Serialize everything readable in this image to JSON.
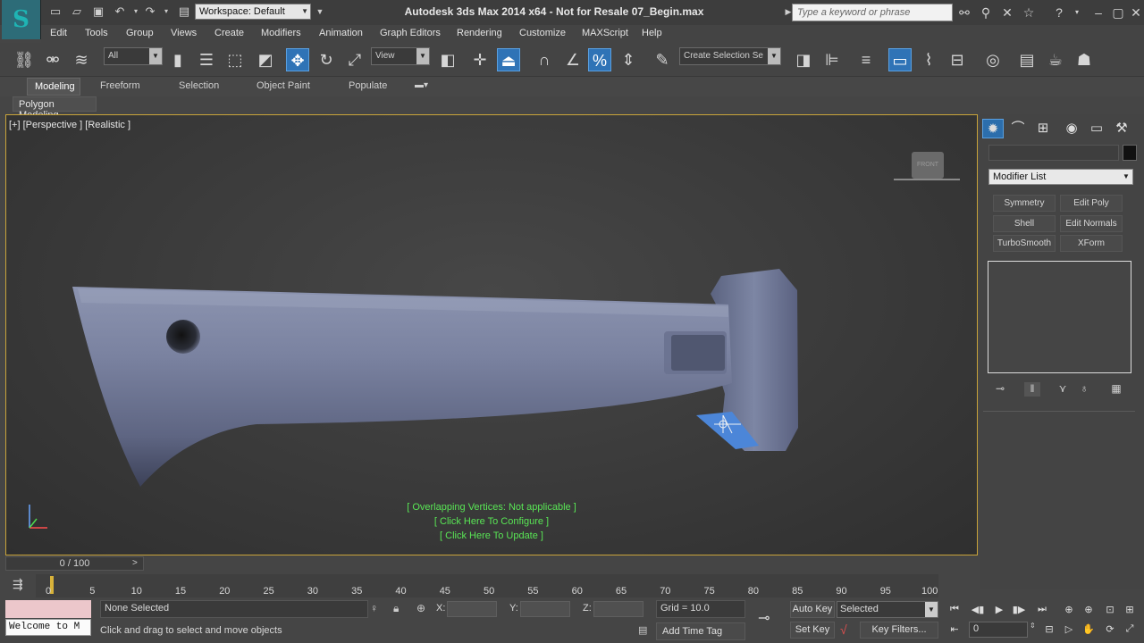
{
  "title": "Autodesk 3ds Max  2014 x64  - Not for Resale   07_Begin.max",
  "workspace": "Workspace: Default",
  "search_placeholder": "Type a keyword or phrase",
  "menu": [
    "Edit",
    "Tools",
    "Group",
    "Views",
    "Create",
    "Modifiers",
    "Animation",
    "Graph Editors",
    "Rendering",
    "Customize",
    "MAXScript",
    "Help"
  ],
  "toolbar": {
    "filter": "All",
    "ref_coord": "View",
    "selection_set": "Create Selection Se"
  },
  "ribbon": {
    "tabs": [
      "Modeling",
      "Freeform",
      "Selection",
      "Object Paint",
      "Populate"
    ],
    "panel": "Polygon Modeling"
  },
  "viewport": {
    "label": "[+] [Perspective ] [Realistic ]",
    "overlay": [
      "[ Overlapping Vertices: Not applicable ]",
      "[ Click Here To Configure ]",
      "[ Click Here To Update ]"
    ],
    "viewcube": "FRONT"
  },
  "command_panel": {
    "modifier_list": "Modifier List",
    "buttons": [
      "Symmetry",
      "Edit Poly",
      "Shell",
      "Edit Normals",
      "TurboSmooth",
      "XForm"
    ]
  },
  "timeline": {
    "slider": "0 / 100",
    "ticks": [
      "0",
      "5",
      "10",
      "15",
      "20",
      "25",
      "30",
      "35",
      "40",
      "45",
      "50",
      "55",
      "60",
      "65",
      "70",
      "75",
      "80",
      "85",
      "90",
      "95",
      "100"
    ]
  },
  "status": {
    "welcome": "Welcome to M",
    "selection": "None Selected",
    "prompt": "Click and drag to select and move objects",
    "x_label": "X:",
    "y_label": "Y:",
    "z_label": "Z:",
    "grid": "Grid = 10.0",
    "add_time_tag": "Add Time Tag",
    "auto_key": "Auto Key",
    "key_mode": "Selected",
    "set_key": "Set Key",
    "key_filters": "Key Filters...",
    "frame": "0"
  }
}
